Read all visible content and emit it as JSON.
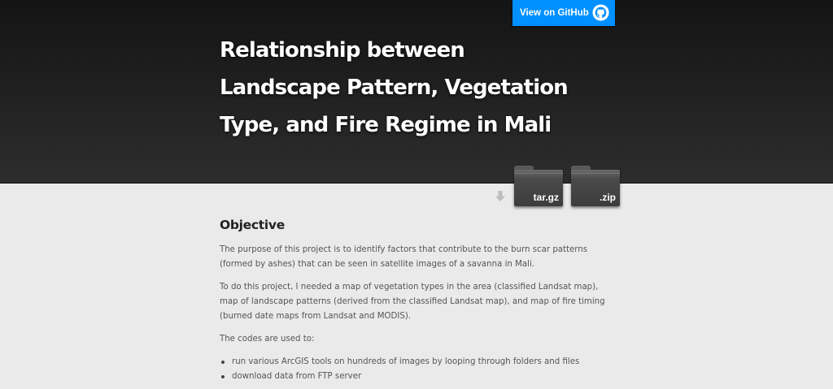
{
  "header": {
    "github_button_label": "View on GitHub",
    "title": "Relationship between Landscape Pattern, Vegetation Type, and Fire Regime in Mali"
  },
  "downloads": [
    {
      "label": "tar.gz"
    },
    {
      "label": ".zip"
    }
  ],
  "main": {
    "heading": "Objective",
    "paragraphs": [
      "The purpose of this project is to identify factors that contribute to the burn scar patterns (formed by ashes) that can be seen in satellite images of a savanna in Mali.",
      "To do this project, I needed a map of vegetation types in the area (classified Landsat map), map of landscape patterns (derived from the classified Landsat map), and map of fire timing (burned date maps from Landsat and MODIS).",
      "The codes are used to:"
    ],
    "list": [
      "run various ArcGIS tools on hundreds of images by looping through folders and files",
      "download data from FTP server"
    ]
  },
  "colors": {
    "accent": "#0090ff",
    "header_bg": "#222222",
    "page_bg": "#eaeaea"
  }
}
